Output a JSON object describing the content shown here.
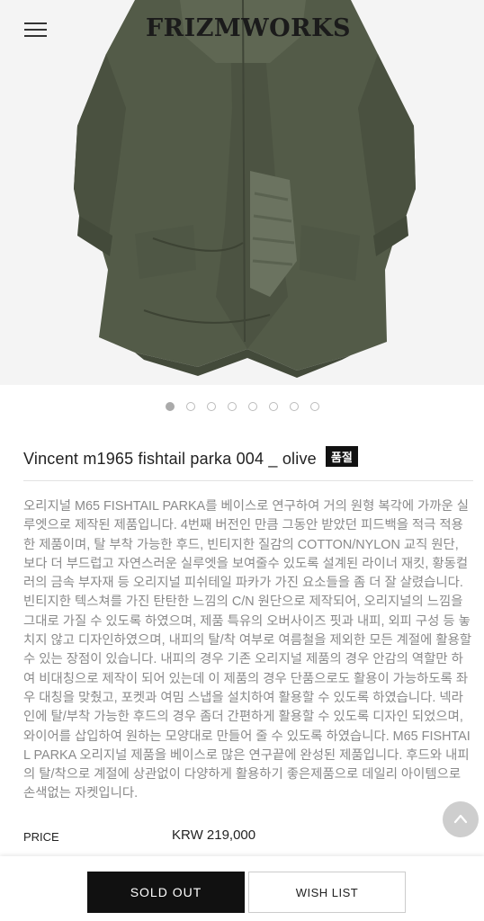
{
  "header": {
    "logo": "FRIZMWORKS",
    "menu_icon": "hamburger-menu-icon"
  },
  "product": {
    "image_icon": "olive-parka-image",
    "slide_count": 8,
    "active_slide": 1,
    "name": "Vincent m1965 fishtail parka 004 _ olive",
    "badge": "품절",
    "description": "오리지널 M65 FISHTAIL PARKA를 베이스로 연구하여 거의 원형 복각에 가까운 실루엣으로 제작된 제품입니다. 4번째 버전인 만큼 그동안 받았던 피드백을 적극 적용한 제품이며, 탈 부착 가능한 후드, 빈티지한 질감의 COTTON/NYLON 교직 원단, 보다 더 부드럽고 자연스러운 실루엣을 보여줄수 있도록 설계된 라이너 재킷, 황동컬러의 금속 부자재 등 오리지널 피쉬테일 파카가 가진 요소들을 좀 더 잘 살렸습니다. 빈티지한 텍스쳐를 가진 탄탄한 느낌의 C/N 원단으로 제작되어, 오리지널의 느낌을 그대로 가질 수 있도록 하였으며, 제품 특유의 오버사이즈 핏과 내피, 외피 구성 등 놓치지 않고 디자인하였으며, 내피의 탈/착 여부로 여름철을 제외한 모든 계절에 활용할 수 있는 장점이 있습니다. 내피의 경우 기존 오리지널 제품의 경우 안감의 역할만 하여 비대칭으로 제작이 되어 있는데 이 제품의 경우 단품으로도 활용이 가능하도록 좌우 대칭을 맞췄고, 포켓과 여밈 스냅을 설치하여 활용할 수 있도록 하였습니다. 넥라인에 탈/부착 가능한 후드의 경우 좀더 간편하게 활용할 수 있도록 디자인 되었으며, 와이어를 삽입하여 원하는 모양대로 만들어 줄 수 있도록 하였습니다. M65 FISHTAIL PARKA 오리지널 제품을 베이스로 많은 연구끝에 완성된 제품입니다. 후드와 내피의 탈/착으로 계절에 상관없이 다양하게 활용하기 좋은제품으로 데일리 아이템으로 손색없는 자켓입니다.",
    "price_label": "PRICE",
    "price_value": "KRW 219,000"
  },
  "actions": {
    "sold_out_label": "SOLD OUT",
    "wish_list_label": "WISH LIST",
    "scroll_top_icon": "chevron-up-icon"
  },
  "colors": {
    "olive_dark": "#4a5140",
    "olive_mid": "#5a6250",
    "olive_light": "#6b7360",
    "button_dark": "#111111"
  }
}
